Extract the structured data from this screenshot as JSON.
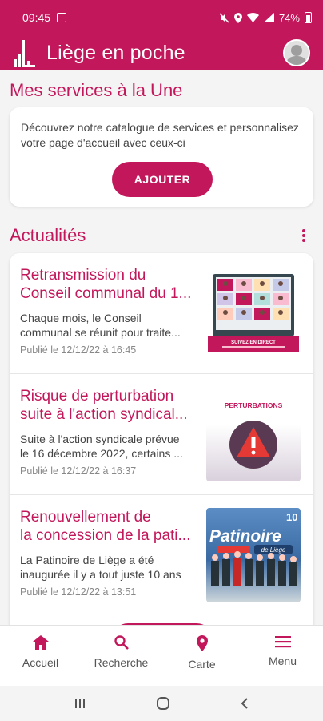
{
  "status_bar": {
    "time": "09:45",
    "battery": "74%"
  },
  "app_bar": {
    "title": "Liège en poche"
  },
  "services": {
    "title": "Mes services à la Une",
    "description": "Découvrez notre catalogue de services et personnalisez votre page d'accueil avec ceux-ci",
    "add_label": "AJOUTER"
  },
  "news": {
    "title": "Actualités",
    "items": [
      {
        "heading_line1": "Retransmission du",
        "heading_line2": "Conseil communal du 1...",
        "body_line1": "Chaque mois, le Conseil",
        "body_line2": "communal se réunit pour traite...",
        "date": "Publié le 12/12/22 à 16:45",
        "thumb_caption": "SUIVEZ EN DIRECT"
      },
      {
        "heading_line1": "Risque de perturbation",
        "heading_line2": "suite à l'action syndical...",
        "body_line1": "Suite à l'action syndicale prévue",
        "body_line2": "le 16 décembre 2022, certains ...",
        "date": "Publié le 12/12/22 à 16:37",
        "thumb_caption": "PERTURBATIONS"
      },
      {
        "heading_line1": "Renouvellement de",
        "heading_line2": "la concession de la pati...",
        "body_line1": "La Patinoire de Liège a été",
        "body_line2": "inaugurée il y a tout juste 10 ans",
        "date": "Publié le 12/12/22 à 13:51",
        "thumb_caption": "Patinoire",
        "thumb_sub": "de Liège",
        "thumb_badge": "10"
      }
    ]
  },
  "bottom_nav": {
    "home": "Accueil",
    "search": "Recherche",
    "map": "Carte",
    "menu": "Menu"
  },
  "colors": {
    "brand": "#c2185b",
    "background": "#f4f4f4"
  }
}
